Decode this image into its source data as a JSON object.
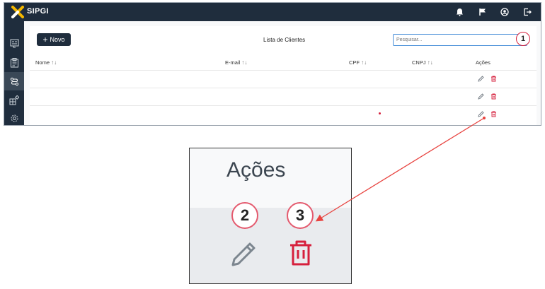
{
  "app": {
    "brand": "SIPGI"
  },
  "toolbar": {
    "new_label": "Novo",
    "list_title": "Lista de Clientes"
  },
  "search": {
    "placeholder": "Pesquisar..."
  },
  "table": {
    "columns": [
      "Nome",
      "E-mail",
      "CPF",
      "CNPJ",
      "Ações"
    ],
    "sort_glyph": "↑↓",
    "row_count": 3
  },
  "annotations": {
    "badge1": "1",
    "badge2": "2",
    "badge3": "3"
  },
  "zoom": {
    "title": "Ações"
  },
  "colors": {
    "navbar": "#1f2d3d",
    "accent_red": "#d6203d",
    "search_border": "#4a90d9"
  },
  "icons": {
    "top": [
      "bell-icon",
      "flag-icon",
      "user-circle-icon",
      "logout-icon"
    ],
    "sidebar": [
      "form-icon",
      "clipboard-icon",
      "route-icon",
      "grid-icon",
      "gear-icon"
    ],
    "row_actions": [
      "pencil-icon",
      "trash-icon"
    ]
  }
}
